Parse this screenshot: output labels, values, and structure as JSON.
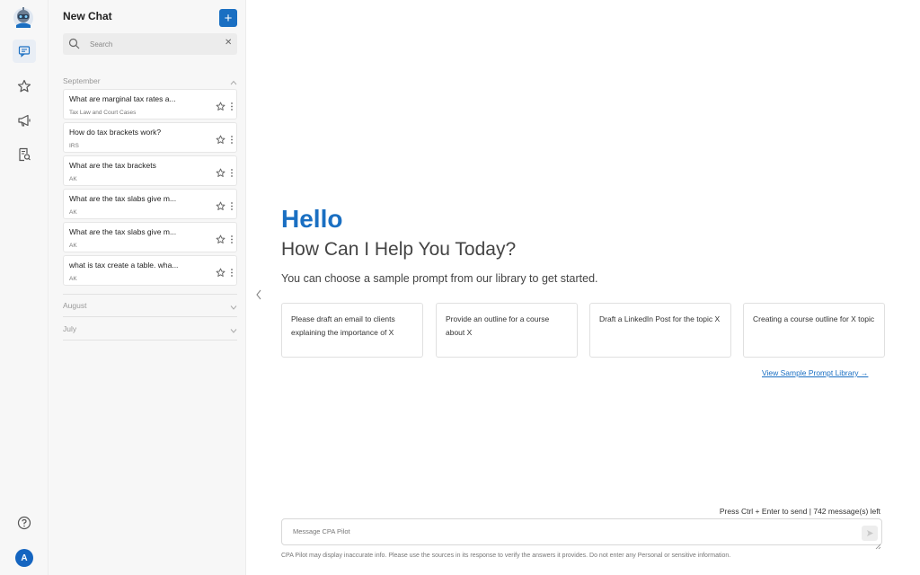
{
  "sidebar_icons": [
    "app-logo",
    "chat-icon",
    "star-icon",
    "megaphone-icon",
    "document-search-icon",
    "help-icon"
  ],
  "user": {
    "avatar_letter": "A"
  },
  "panel": {
    "title": "New Chat",
    "new_button_label": "+",
    "search": {
      "placeholder": "Search",
      "value": "",
      "clear_label": "✕"
    }
  },
  "groups": [
    {
      "label": "September",
      "expanded": true,
      "chats": [
        {
          "title": "What are marginal tax rates a...",
          "subtitle": "Tax Law and Court Cases"
        },
        {
          "title": "How do tax brackets work?",
          "subtitle": "IRS"
        },
        {
          "title": "What are the tax brackets",
          "subtitle": "AK"
        },
        {
          "title": "What are the tax slabs give m...",
          "subtitle": "AK"
        },
        {
          "title": "What are the tax slabs give m...",
          "subtitle": "AK"
        },
        {
          "title": "what is tax create a table. wha...",
          "subtitle": "AK"
        }
      ]
    },
    {
      "label": "August",
      "expanded": false,
      "chats": []
    },
    {
      "label": "July",
      "expanded": false,
      "chats": []
    }
  ],
  "main": {
    "greeting": "Hello",
    "heading": "How Can I Help You Today?",
    "subheading": "You can choose a sample prompt from our library to get started.",
    "prompts": [
      "Please draft an email to clients explaining the importance of X",
      "Provide an outline for a course about X",
      "Draft a LinkedIn Post for the topic X",
      "Creating a course outline for X topic"
    ],
    "library_link": "View Sample Prompt Library →",
    "send_hint": "Press Ctrl + Enter to send | 742 message(s) left",
    "message_placeholder": "Message CPA Pilot",
    "message_value": "",
    "disclaimer": "CPA Pilot may display inaccurate info. Please use the sources in its response to verify the answers it provides. Do not enter any Personal or sensitive information."
  },
  "colors": {
    "accent": "#1a6fc2",
    "sidebar_bg": "#f7f7f7"
  }
}
